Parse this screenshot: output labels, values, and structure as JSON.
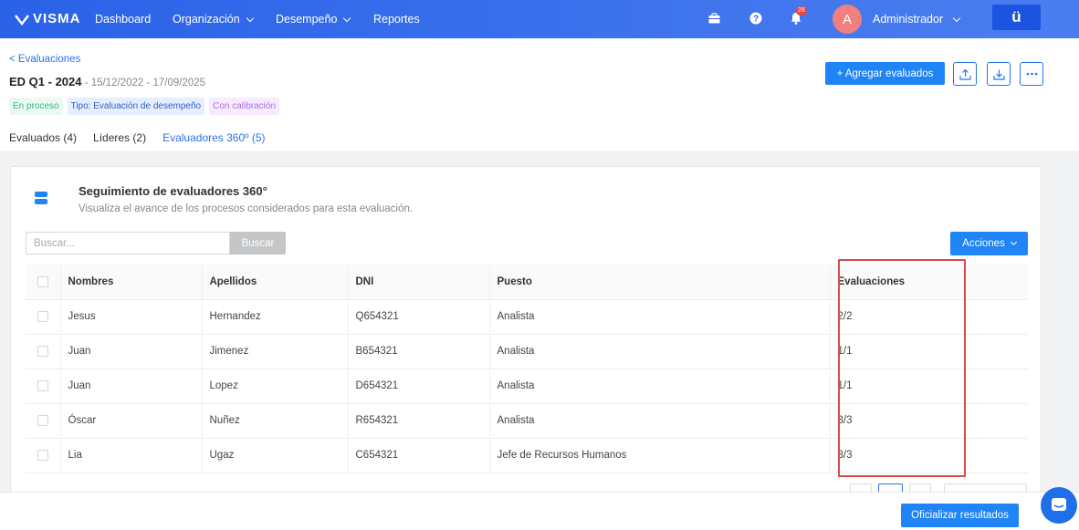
{
  "nav": {
    "logo": "VISMA",
    "items": [
      {
        "label": "Dashboard"
      },
      {
        "label": "Organización"
      },
      {
        "label": "Desempeño"
      },
      {
        "label": "Reportes"
      }
    ],
    "notification_count": "28",
    "avatar_letter": "A",
    "user_name": "Administrador",
    "brand_badge": "ü"
  },
  "header": {
    "back_link": "< Evaluaciones",
    "title": "ED Q1 - 2024",
    "dates": " - 15/12/2022 - 17/09/2025",
    "tags": [
      "En proceso",
      "Tipo: Evaluación de desempeño",
      "Con calibración"
    ],
    "add_button": "+ Agregar evaluados"
  },
  "tabs": [
    {
      "label": "Evaluados (4)"
    },
    {
      "label": "Líderes (2)"
    },
    {
      "label": "Evaluadores 360º (5)"
    }
  ],
  "card": {
    "title": "Seguimiento de evaluadores 360°",
    "subtitle": "Visualiza el avance de los procesos considerados para esta evaluación.",
    "search_placeholder": "Buscar...",
    "search_button": "Buscar",
    "actions_button": "Acciones"
  },
  "table": {
    "headers": [
      "Nombres",
      "Apellidos",
      "DNI",
      "Puesto",
      "Evaluaciones"
    ],
    "rows": [
      [
        "Jesus",
        "Hernandez",
        "Q654321",
        "Analista",
        "2/2"
      ],
      [
        "Juan",
        "Jimenez",
        "B654321",
        "Analista",
        "1/1"
      ],
      [
        "Juan",
        "Lopez",
        "D654321",
        "Analista",
        "1/1"
      ],
      [
        "Óscar",
        "Nuñez",
        "R654321",
        "Analista",
        "3/3"
      ],
      [
        "Lia",
        "Ugaz",
        "C654321",
        "Jefe de Recursos Humanos",
        "3/3"
      ]
    ]
  },
  "footer": {
    "officialize_button": "Oficializar resultados"
  },
  "colors": {
    "nav": "#2a62e8",
    "primary": "#1f84f5",
    "highlight": "#d84a4a"
  }
}
